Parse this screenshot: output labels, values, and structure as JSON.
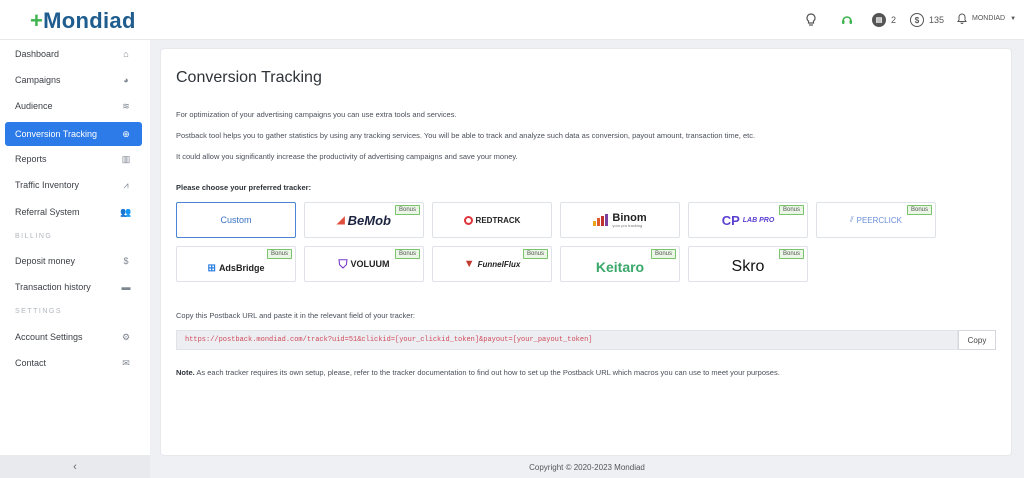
{
  "header": {
    "logo_text": "Mondiad",
    "logo_plus": "+",
    "messages_count": "2",
    "balance": "135",
    "user_name": "MONDIAD"
  },
  "sidebar": {
    "items": [
      {
        "label": "Dashboard",
        "icon": "home-icon"
      },
      {
        "label": "Campaigns",
        "icon": "pie-chart-icon"
      },
      {
        "label": "Audience",
        "icon": "layers-icon"
      },
      {
        "label": "Conversion Tracking",
        "icon": "globe-icon"
      },
      {
        "label": "Reports",
        "icon": "bar-chart-icon"
      },
      {
        "label": "Traffic Inventory",
        "icon": "line-chart-icon"
      },
      {
        "label": "Referral System",
        "icon": "users-icon"
      }
    ],
    "billing_label": "BILLING",
    "billing_items": [
      {
        "label": "Deposit money",
        "icon": "dollar-icon"
      },
      {
        "label": "Transaction history",
        "icon": "wallet-icon"
      }
    ],
    "settings_label": "SETTINGS",
    "settings_items": [
      {
        "label": "Account Settings",
        "icon": "gears-icon"
      },
      {
        "label": "Contact",
        "icon": "envelope-icon"
      }
    ]
  },
  "main": {
    "title": "Conversion Tracking",
    "para1": "For optimization of your advertising campaigns you can use extra tools and services.",
    "para2": "Postback tool helps you to gather statistics by using any tracking services. You will be able to track and analyze such data as conversion, payout amount, transaction time, etc.",
    "para3": "It could allow you significantly increase the productivity of advertising campaigns and save your money.",
    "choose_label": "Please choose your preferred tracker:",
    "trackers": [
      {
        "name": "Custom",
        "bonus": ""
      },
      {
        "name": "BeMob",
        "bonus": "Bonus"
      },
      {
        "name": "REDTRACK",
        "bonus": ""
      },
      {
        "name": "Binom",
        "bonus": ""
      },
      {
        "name": "LAB PRO",
        "bonus": "Bonus"
      },
      {
        "name": "PEERCLICK",
        "bonus": "Bonus"
      },
      {
        "name": "AdsBridge",
        "bonus": "Bonus"
      },
      {
        "name": "VOLUUM",
        "bonus": "Bonus"
      },
      {
        "name": "FunnelFlux",
        "bonus": "Bonus"
      },
      {
        "name": "Keitaro",
        "bonus": "Bonus"
      },
      {
        "name": "Skro",
        "bonus": "Bonus"
      }
    ],
    "binom_sub": "your pro tracking",
    "copy_label": "Copy this Postback URL and paste it in the relevant field of your tracker:",
    "postback_url": "https://postback.mondiad.com/track?uid=51&clickid=[your_clickid_token]&payout=[your_payout_token]",
    "copy_button": "Copy",
    "note_bold": "Note.",
    "note_text": " As each tracker requires its own setup, please, refer to the tracker documentation to find out how to set up the Postback URL which macros you can use to meet your purposes."
  },
  "footer": {
    "copyright": "Copyright © 2020-2023 Mondiad"
  },
  "colors": {
    "accent": "#2d7be8",
    "logo": "#1f5d8f",
    "bonus_border": "#79c46a",
    "url_text": "#d14a5c"
  }
}
